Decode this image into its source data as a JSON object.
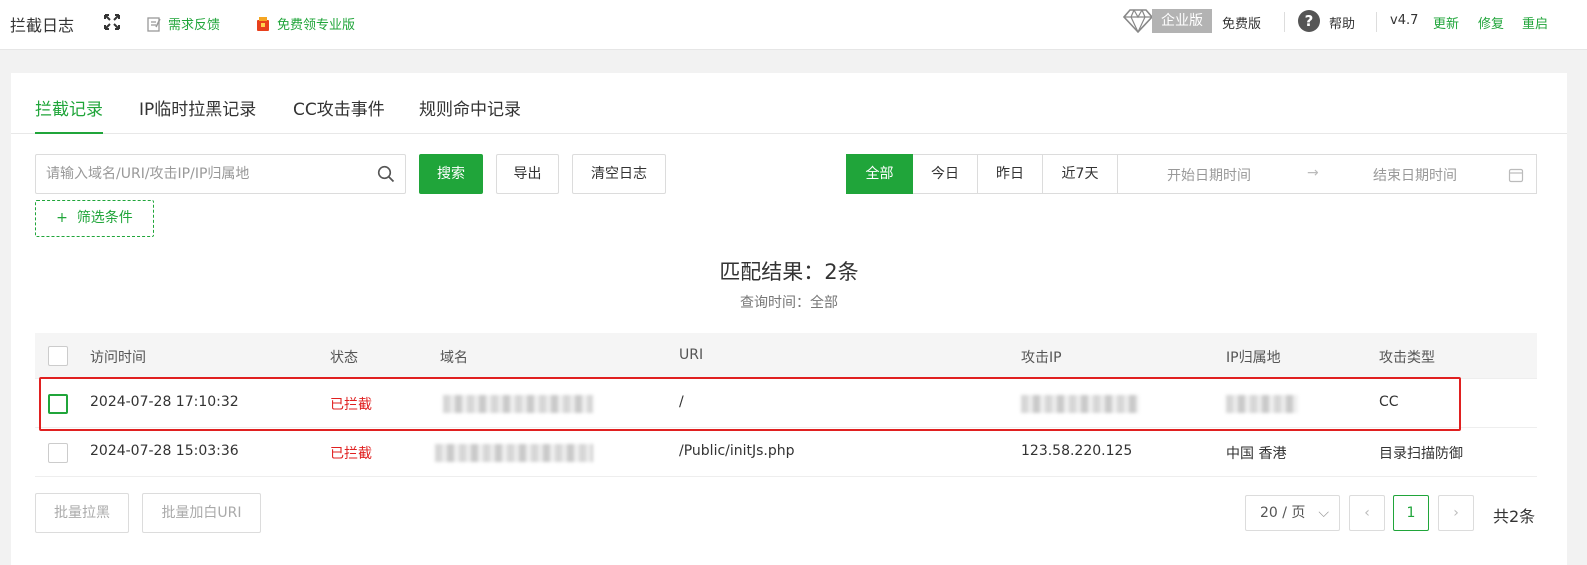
{
  "header": {
    "title": "拦截日志",
    "feedback_label": "需求反馈",
    "pro_label": "免费领专业版",
    "enterprise_badge": "企业版",
    "free_label": "免费版",
    "help_label": "帮助",
    "version": "v4.7",
    "update_label": "更新",
    "repair_label": "修复",
    "restart_label": "重启"
  },
  "tabs": [
    {
      "label": "拦截记录",
      "active": true
    },
    {
      "label": "IP临时拉黑记录",
      "active": false
    },
    {
      "label": "CC攻击事件",
      "active": false
    },
    {
      "label": "规则命中记录",
      "active": false
    }
  ],
  "toolbar": {
    "search_placeholder": "请输入域名/URI/攻击IP/IP归属地",
    "search_label": "搜索",
    "export_label": "导出",
    "clear_label": "清空日志",
    "filter_label": "筛选条件",
    "filter_plus": "+"
  },
  "date_filter": {
    "options": [
      "全部",
      "今日",
      "昨日",
      "近7天"
    ],
    "active": "全部",
    "start_placeholder": "开始日期时间",
    "arrow": "→",
    "end_placeholder": "结束日期时间"
  },
  "result": {
    "title": "匹配结果：2条",
    "query_time": "查询时间：全部"
  },
  "table": {
    "columns": [
      "访问时间",
      "状态",
      "域名",
      "URI",
      "攻击IP",
      "IP归属地",
      "攻击类型"
    ],
    "rows": [
      {
        "time": "2024-07-28 17:10:32",
        "status": "已拦截",
        "domain": "",
        "uri": "/",
        "ip": "",
        "location": "",
        "type": "CC"
      },
      {
        "time": "2024-07-28 15:03:36",
        "status": "已拦截",
        "domain": "",
        "uri": "/Public/initJs.php",
        "ip": "123.58.220.125",
        "location": "中国 香港",
        "type": "目录扫描防御"
      }
    ]
  },
  "footer": {
    "batch_block_label": "批量拉黑",
    "batch_whitelist_label": "批量加白URI",
    "page_size": "20 / 页",
    "prev": "‹",
    "current_page": "1",
    "next": "›",
    "total": "共2条"
  },
  "colors": {
    "accent": "#20a53a",
    "danger": "#e02020"
  }
}
